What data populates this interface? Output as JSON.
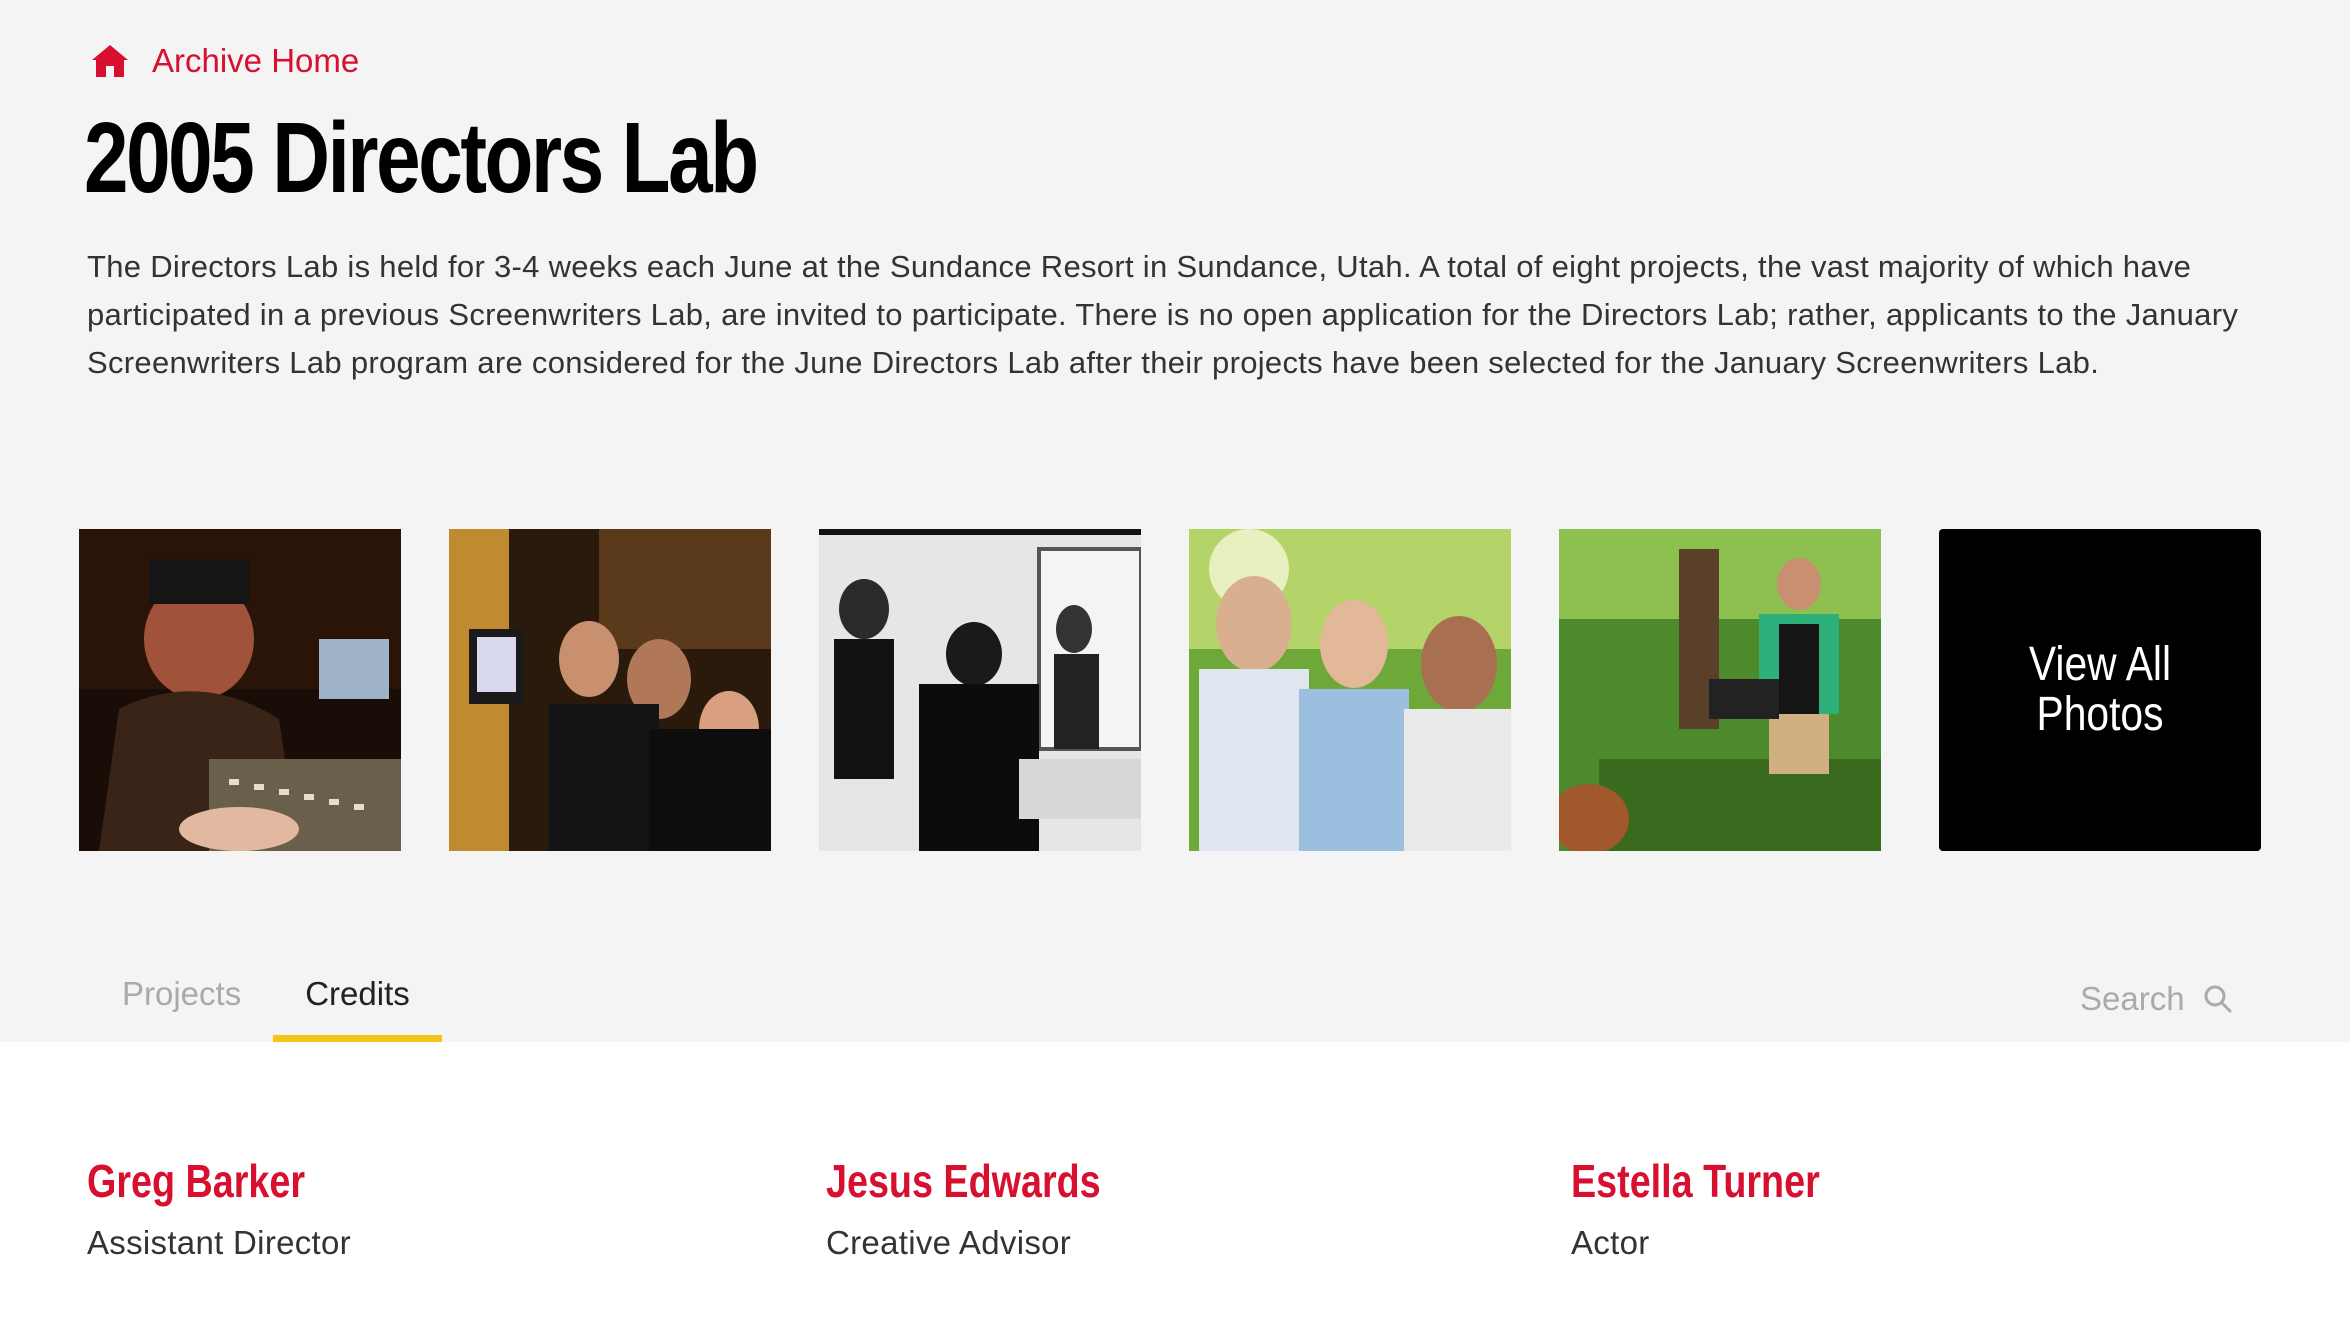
{
  "breadcrumb": {
    "label": "Archive Home",
    "icon": "home-icon"
  },
  "page": {
    "title": "2005 Directors Lab",
    "description": "The Directors Lab is held for 3-4 weeks each June at the Sundance Resort in Sundance, Utah. A total of eight projects, the vast majority of which have participated in a previous Screenwriters Lab, are invited to participate. There is no open application for the Directors Lab; rather, applicants to the January Screenwriters Lab program are considered for the June Directors Lab after their projects have been selected for the January Screenwriters Lab."
  },
  "gallery": {
    "view_all_label": "View All Photos"
  },
  "tabs": [
    {
      "label": "Projects",
      "active": false
    },
    {
      "label": "Credits",
      "active": true
    }
  ],
  "search": {
    "placeholder": "Search",
    "icon": "search-icon"
  },
  "credits": [
    {
      "name": "Greg Barker",
      "role": "Assistant Director"
    },
    {
      "name": "Jesus Edwards",
      "role": "Creative Advisor"
    },
    {
      "name": "Estella Turner",
      "role": "Actor"
    }
  ],
  "colors": {
    "accent": "#d8102f",
    "tab_underline": "#f5c518",
    "header_bg": "#f4f4f4"
  }
}
